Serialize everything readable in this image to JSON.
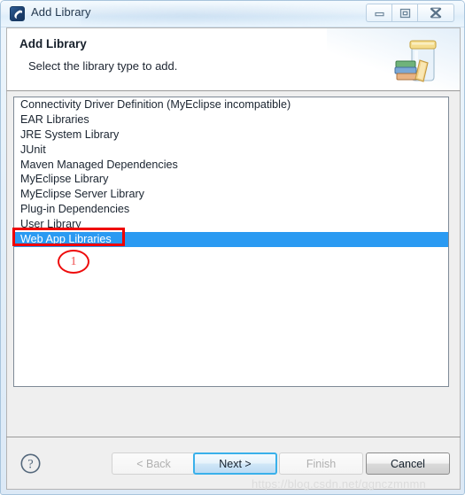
{
  "window": {
    "title": "Add Library",
    "app_icon": "eclipse-j-icon",
    "controls": {
      "minimize": "minimize-icon",
      "maximize": "maximize-icon",
      "close": "close-icon"
    }
  },
  "header": {
    "title": "Add Library",
    "description": "Select the library type to add.",
    "icon": "library-jar-books-icon"
  },
  "library_list": {
    "items": [
      {
        "label": "Connectivity Driver Definition (MyEclipse incompatible)",
        "selected": false
      },
      {
        "label": "EAR Libraries",
        "selected": false
      },
      {
        "label": "JRE System Library",
        "selected": false
      },
      {
        "label": "JUnit",
        "selected": false
      },
      {
        "label": "Maven Managed Dependencies",
        "selected": false
      },
      {
        "label": "MyEclipse Library",
        "selected": false
      },
      {
        "label": "MyEclipse Server Library",
        "selected": false
      },
      {
        "label": "Plug-in Dependencies",
        "selected": false
      },
      {
        "label": "User Library",
        "selected": false
      },
      {
        "label": "Web App Libraries",
        "selected": true
      }
    ],
    "selected_value": "Web App Libraries",
    "selection_color": "#2a9af2"
  },
  "annotations": {
    "highlight_color": "#ef0000",
    "step_number": "1"
  },
  "footer": {
    "help_icon": "help-question-icon",
    "buttons": [
      {
        "label": "< Back",
        "state": "disabled"
      },
      {
        "label": "Next >",
        "state": "default"
      },
      {
        "label": "Finish",
        "state": "disabled"
      },
      {
        "label": "Cancel",
        "state": "enabled"
      }
    ]
  },
  "watermark": "https://blog.csdn.net/qgnczmnmn"
}
